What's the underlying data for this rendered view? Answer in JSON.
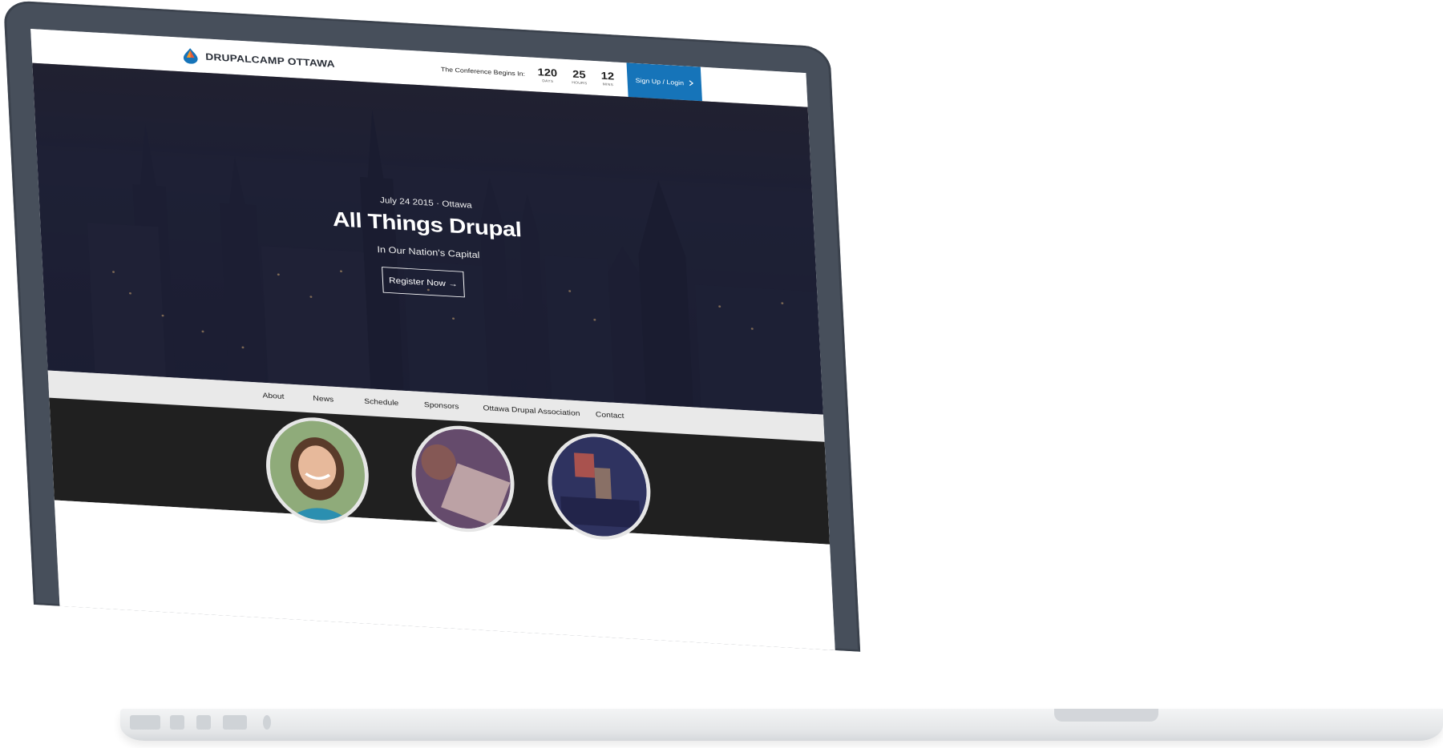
{
  "site": {
    "logo_text": "DRUPALCAMP OTTAWA",
    "countdown": {
      "label": "The Conference Begins In:",
      "units": [
        {
          "value": "120",
          "caption": "DAYS"
        },
        {
          "value": "25",
          "caption": "HOURS"
        },
        {
          "value": "12",
          "caption": "MINS"
        }
      ]
    },
    "signup_label": "Sign Up / Login"
  },
  "hero": {
    "date": "July 24 2015 · Ottawa",
    "title": "All Things Drupal",
    "subtitle": "In Our Nation's Capital",
    "register_label": "Register Now →"
  },
  "nav": {
    "items": [
      "About",
      "News",
      "Schedule",
      "Sponsors",
      "Ottawa Drupal Association",
      "Contact"
    ]
  },
  "colors": {
    "accent": "#1674b9",
    "bezel": "#474f5b",
    "dark_band": "#202020",
    "nav_bg": "#e9e9e9"
  },
  "icons": [
    "drupal-drop-logo-icon",
    "chevron-right-icon"
  ]
}
